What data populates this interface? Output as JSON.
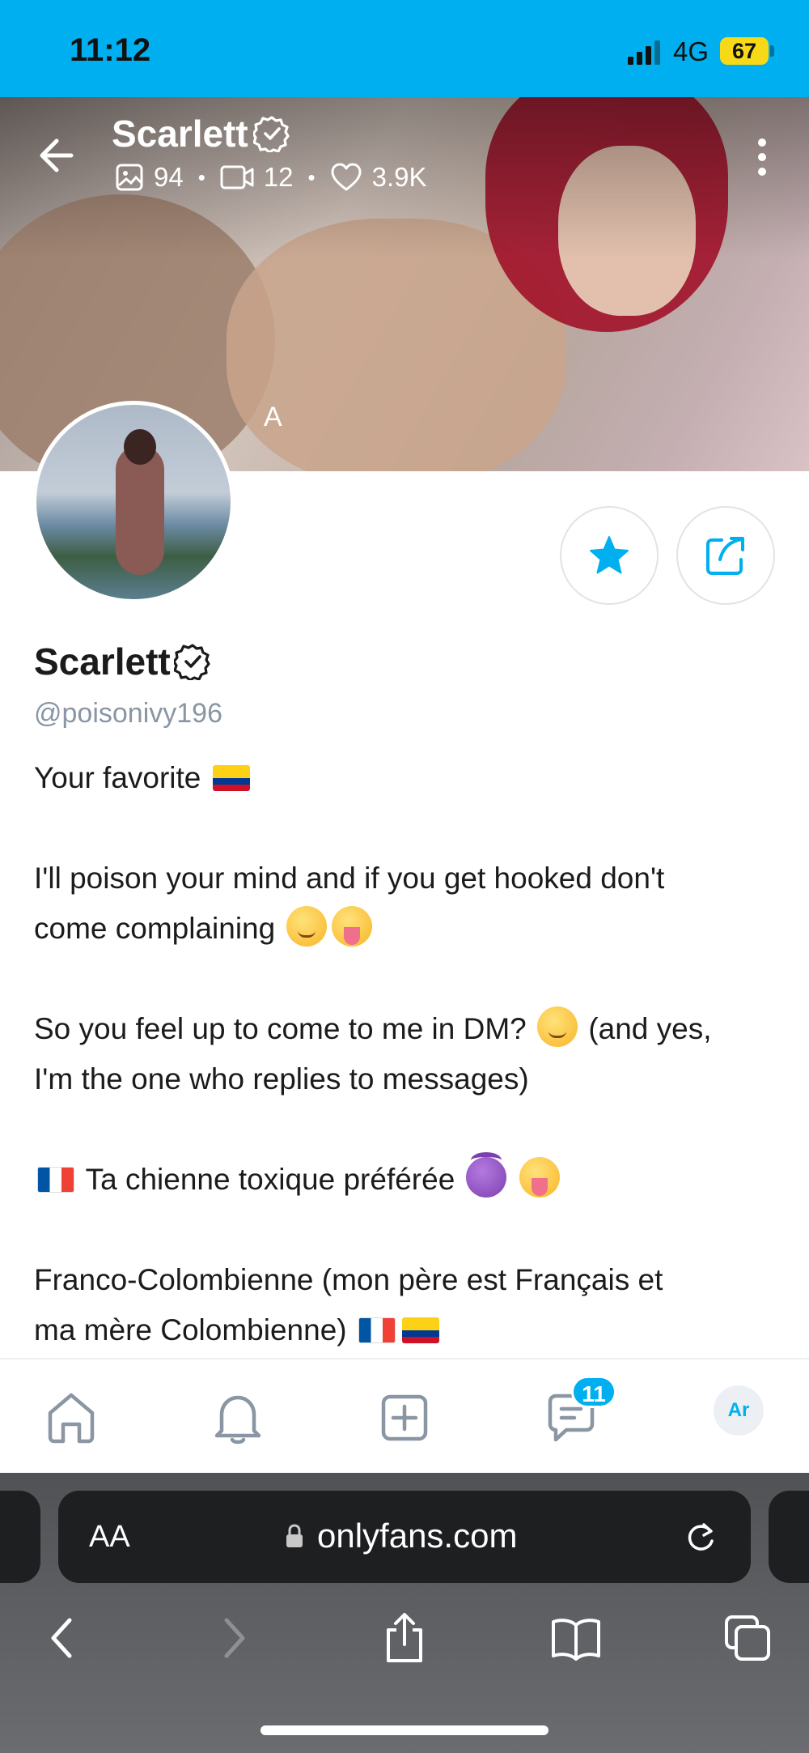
{
  "status_bar": {
    "time": "11:12",
    "network": "4G",
    "battery": "67"
  },
  "header": {
    "title": "Scarlett",
    "stats": {
      "photos": "94",
      "videos": "12",
      "likes": "3.9K"
    },
    "cover_letter": "A"
  },
  "profile": {
    "name": "Scarlett",
    "handle": "@poisonivy196",
    "bio": {
      "line1": "Your favorite",
      "line2a": "I'll poison your mind and if you get hooked don't",
      "line2b": "come complaining",
      "line3a": "So you feel up to come to me in DM?",
      "line3a_tail": "(and yes,",
      "line3b": "I'm the one who replies to messages)",
      "line4": "Ta chienne toxique préférée",
      "line5a": "Franco-Colombienne (mon père est Français et",
      "line5b": "ma mère Colombienne)"
    }
  },
  "bottom_nav": {
    "messages_badge": "11",
    "avatar_initials": "Ar"
  },
  "browser": {
    "text_size_label": "AA",
    "url": "onlyfans.com"
  },
  "colors": {
    "brand": "#00aff0",
    "text": "#1b1b1b",
    "muted": "#8a96a3"
  }
}
